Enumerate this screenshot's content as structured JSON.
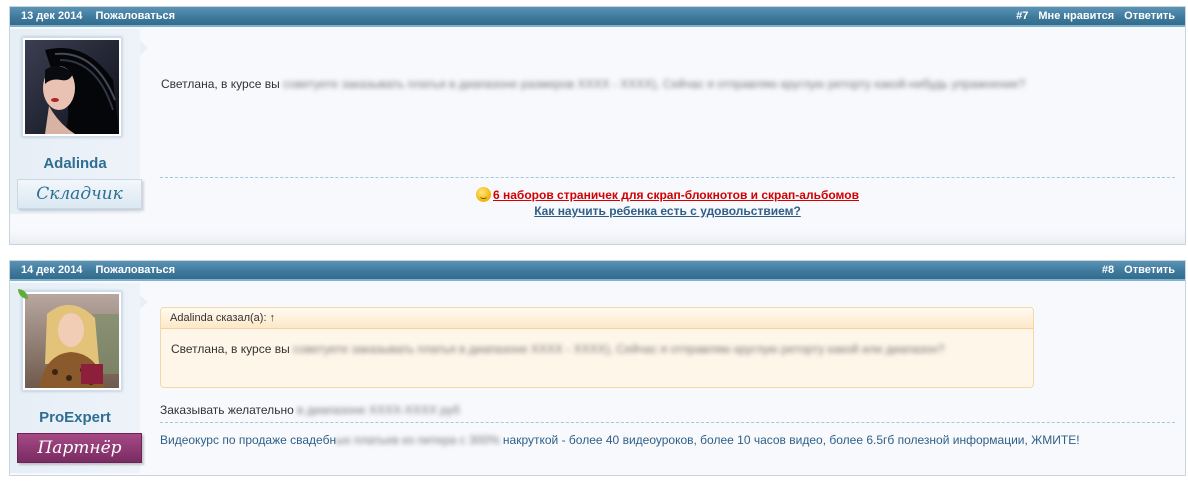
{
  "posts": [
    {
      "date": "13 дек 2014",
      "report": "Пожаловаться",
      "number": "#7",
      "like": "Мне нравится",
      "reply": "Ответить",
      "author": "Adalinda",
      "rank": "Складчик",
      "text_visible": "Светлана, в курсе вы ",
      "text_blurred": "советуете заказывать платья в диапазоне размеров XXXX - XXXX), Сейчас я отправляю круглую реторту какой-нибудь упражнение?",
      "signature_link_1": "6 наборов страничек для скрап-блокнотов и скрап-альбомов",
      "signature_link_2": "Как научить ребенка есть с удовольствием?"
    },
    {
      "date": "14 дек 2014",
      "report": "Пожаловаться",
      "number": "#8",
      "reply": "Ответить",
      "author": "ProExpert",
      "rank": "Партнёр",
      "quote_header": "Adalinda сказал(а): ↑",
      "quote_visible": "Светлана, в курсе вы ",
      "quote_blurred": "советуете заказывать платья в диапазоне XXXX - XXXX), Сейчас я отправляю круглую реторту какой или диапазон?",
      "reply_visible": "Заказывать желательно ",
      "reply_blurred": "в диапазоне XXXX-XXXX руб",
      "footer_visible_1": "Видеокурс по продаже свадебн",
      "footer_blurred": "ых платьев из питера с 300% ",
      "footer_visible_2": "накруткой - более 40 видеоуроков, более 10 часов видео, более 6.5гб полезной информации, ЖМИТЕ!"
    }
  ],
  "colors": {
    "header_bar": "#3f7a9d",
    "link_red": "#d20000",
    "link_blue": "#2f5f88",
    "nick": "#2f6e93"
  }
}
